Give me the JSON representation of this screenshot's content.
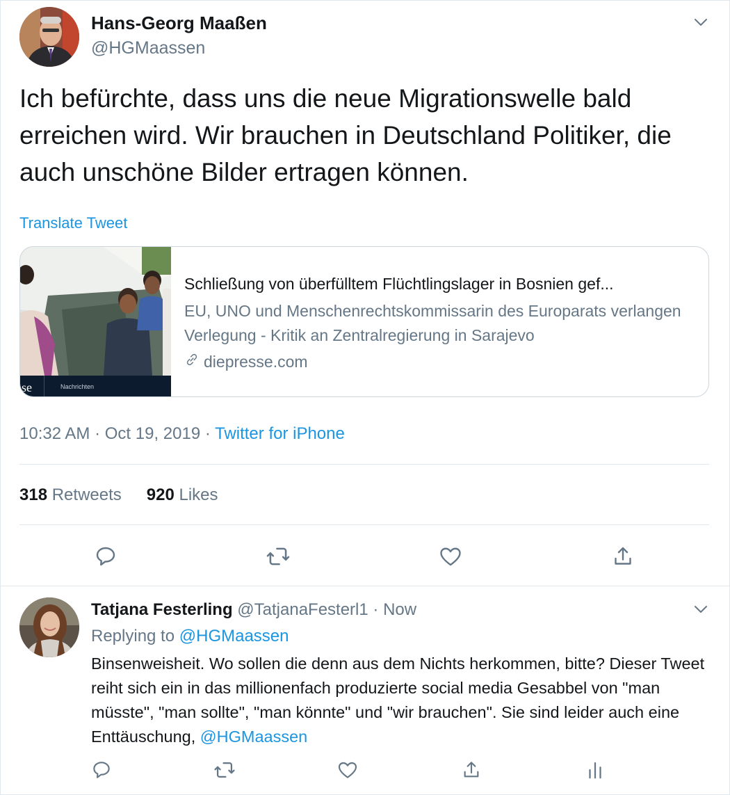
{
  "main_tweet": {
    "author": {
      "display_name": "Hans-Georg Maaßen",
      "handle": "@HGMaassen"
    },
    "text": "Ich befürchte, dass uns die neue Migrationswelle bald erreichen wird. Wir brauchen in Deutschland Politiker, die auch unschöne Bilder ertragen können.",
    "translate_label": "Translate Tweet",
    "card": {
      "image_caption_left": "se",
      "image_caption_right": "Nachrichten",
      "title": "Schließung von überfülltem Flüchtlingslager in Bosnien gef...",
      "description": "EU, UNO und Menschenrechtskommissarin des Europarats verlangen Verlegung - Kritik an Zentralregierung in Sarajevo",
      "domain": "diepresse.com"
    },
    "meta": {
      "time": "10:32 AM",
      "separator": "·",
      "date": "Oct 19, 2019",
      "source": "Twitter for iPhone"
    },
    "stats": {
      "retweets_count": "318",
      "retweets_label": "Retweets",
      "likes_count": "920",
      "likes_label": "Likes"
    },
    "actions": [
      "reply-icon",
      "retweet-icon",
      "like-icon",
      "share-icon"
    ]
  },
  "reply": {
    "author": {
      "display_name": "Tatjana Festerling",
      "handle": "@TatjanaFesterl1",
      "separator": "·",
      "time": "Now"
    },
    "replying_to_label": "Replying to",
    "replying_to_handle": "@HGMaassen",
    "text": "Binsenweisheit. Wo sollen die denn aus dem Nichts herkommen, bitte? Dieser Tweet reiht sich ein in das millionenfach produzierte social media Gesabbel von \"man müsste\", \"man sollte\", \"man könnte\" und \"wir brauchen\". Sie sind leider auch eine Enttäuschung,",
    "text_mention": "@HGMaassen",
    "actions": [
      "reply-icon",
      "retweet-icon",
      "like-icon",
      "share-icon",
      "analytics-icon"
    ]
  },
  "colors": {
    "link_blue": "#1b95e0",
    "secondary_gray": "#657786",
    "text_dark": "#14171a",
    "divider": "#e1e8ed"
  }
}
